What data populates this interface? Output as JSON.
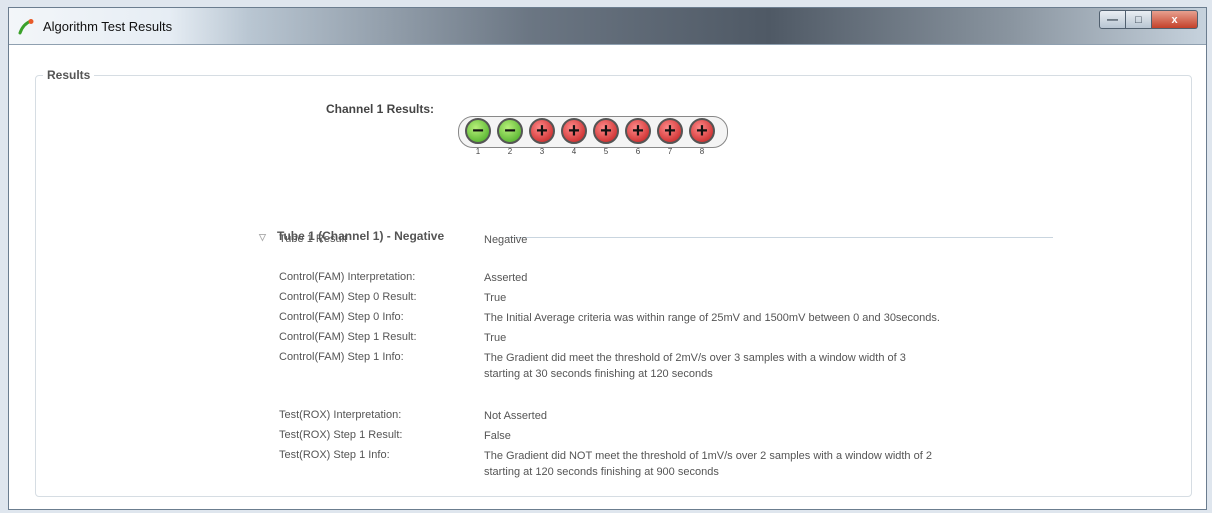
{
  "window": {
    "title": "Algorithm Test Results",
    "buttons": {
      "minimize": "—",
      "maximize": "□",
      "close": "x"
    }
  },
  "results": {
    "group_label": "Results",
    "channel_title": "Channel 1 Results:",
    "tubes": [
      {
        "number": "1",
        "result": "negative"
      },
      {
        "number": "2",
        "result": "negative"
      },
      {
        "number": "3",
        "result": "positive"
      },
      {
        "number": "4",
        "result": "positive"
      },
      {
        "number": "5",
        "result": "positive"
      },
      {
        "number": "6",
        "result": "positive"
      },
      {
        "number": "7",
        "result": "positive"
      },
      {
        "number": "8",
        "result": "positive"
      }
    ],
    "section_title": "Tube 1 (Channel 1) - Negative",
    "rows": [
      {
        "label": "Tube 1 Result",
        "value": "Negative"
      },
      {
        "label": "Control(FAM) Interpretation:",
        "value": "Asserted"
      },
      {
        "label": "Control(FAM) Step 0 Result:",
        "value": "True"
      },
      {
        "label": "Control(FAM) Step 0 Info:",
        "value": "The Initial Average criteria was within range of 25mV and 1500mV between 0 and 30seconds."
      },
      {
        "label": "Control(FAM) Step 1 Result:",
        "value": "True"
      },
      {
        "label": "Control(FAM) Step 1 Info:",
        "value": "The Gradient did meet the threshold of 2mV/s over 3 samples with a window width of 3",
        "value2": "starting at 30 seconds finishing at 120 seconds"
      },
      {
        "label": "Test(ROX) Interpretation:",
        "value": "Not Asserted"
      },
      {
        "label": "Test(ROX) Step 1 Result:",
        "value": "False"
      },
      {
        "label": "Test(ROX) Step 1 Info:",
        "value": "The Gradient did NOT meet the threshold of 1mV/s over 2 samples with a window width of 2",
        "value2": "starting at 120 seconds finishing at 900 seconds"
      }
    ]
  },
  "colors": {
    "negative": "#3fa51e",
    "positive": "#c01818"
  }
}
